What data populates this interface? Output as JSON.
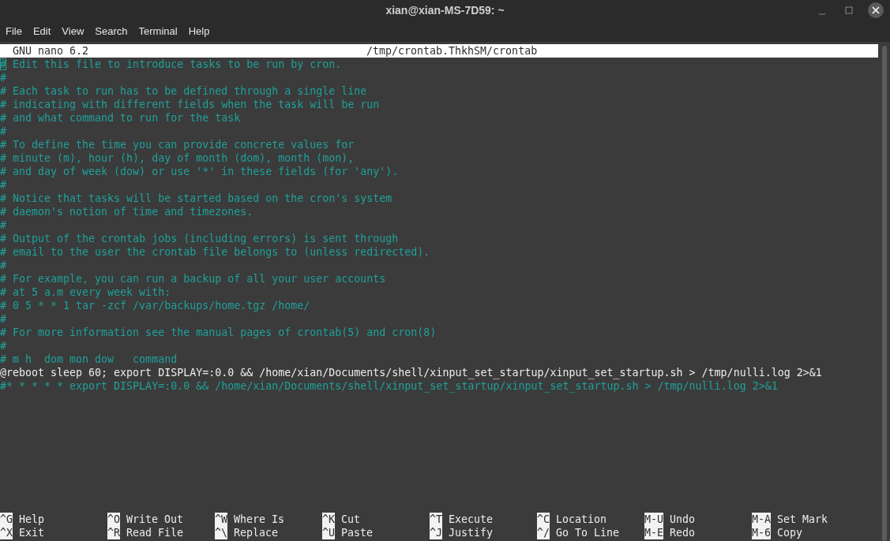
{
  "window": {
    "title": "xian@xian-MS-7D59: ~"
  },
  "menu": [
    "File",
    "Edit",
    "View",
    "Search",
    "Terminal",
    "Help"
  ],
  "header": {
    "version": "GNU nano 6.2",
    "filename": "/tmp/crontab.ThkhSM/crontab"
  },
  "lines": [
    {
      "text": "# Edit this file to introduce tasks to be run by cron.",
      "kind": "comment",
      "cursor": true
    },
    {
      "text": "#",
      "kind": "comment",
      "cursor": false
    },
    {
      "text": "# Each task to run has to be defined through a single line",
      "kind": "comment",
      "cursor": false
    },
    {
      "text": "# indicating with different fields when the task will be run",
      "kind": "comment",
      "cursor": false
    },
    {
      "text": "# and what command to run for the task",
      "kind": "comment",
      "cursor": false
    },
    {
      "text": "#",
      "kind": "comment",
      "cursor": false
    },
    {
      "text": "# To define the time you can provide concrete values for",
      "kind": "comment",
      "cursor": false
    },
    {
      "text": "# minute (m), hour (h), day of month (dom), month (mon),",
      "kind": "comment",
      "cursor": false
    },
    {
      "text": "# and day of week (dow) or use '*' in these fields (for 'any').",
      "kind": "comment",
      "cursor": false
    },
    {
      "text": "#",
      "kind": "comment",
      "cursor": false
    },
    {
      "text": "# Notice that tasks will be started based on the cron's system",
      "kind": "comment",
      "cursor": false
    },
    {
      "text": "# daemon's notion of time and timezones.",
      "kind": "comment",
      "cursor": false
    },
    {
      "text": "#",
      "kind": "comment",
      "cursor": false
    },
    {
      "text": "# Output of the crontab jobs (including errors) is sent through",
      "kind": "comment",
      "cursor": false
    },
    {
      "text": "# email to the user the crontab file belongs to (unless redirected).",
      "kind": "comment",
      "cursor": false
    },
    {
      "text": "#",
      "kind": "comment",
      "cursor": false
    },
    {
      "text": "# For example, you can run a backup of all your user accounts",
      "kind": "comment",
      "cursor": false
    },
    {
      "text": "# at 5 a.m every week with:",
      "kind": "comment",
      "cursor": false
    },
    {
      "text": "# 0 5 * * 1 tar -zcf /var/backups/home.tgz /home/",
      "kind": "comment",
      "cursor": false
    },
    {
      "text": "#",
      "kind": "comment",
      "cursor": false
    },
    {
      "text": "# For more information see the manual pages of crontab(5) and cron(8)",
      "kind": "comment",
      "cursor": false
    },
    {
      "text": "#",
      "kind": "comment",
      "cursor": false
    },
    {
      "text": "# m h  dom mon dow   command",
      "kind": "comment",
      "cursor": false
    },
    {
      "text": "@reboot sleep 60; export DISPLAY=:0.0 && /home/xian/Documents/shell/xinput_set_startup/xinput_set_startup.sh > /tmp/nulli.log 2>&1",
      "kind": "command",
      "cursor": false
    },
    {
      "text": "#* * * * * export DISPLAY=:0.0 && /home/xian/Documents/shell/xinput_set_startup/xinput_set_startup.sh > /tmp/nulli.log 2>&1",
      "kind": "comment",
      "cursor": false
    }
  ],
  "shortcuts": [
    [
      {
        "key": "^G",
        "label": "Help"
      },
      {
        "key": "^X",
        "label": "Exit"
      }
    ],
    [
      {
        "key": "^O",
        "label": "Write Out"
      },
      {
        "key": "^R",
        "label": "Read File"
      }
    ],
    [
      {
        "key": "^W",
        "label": "Where Is"
      },
      {
        "key": "^\\",
        "label": "Replace"
      }
    ],
    [
      {
        "key": "^K",
        "label": "Cut"
      },
      {
        "key": "^U",
        "label": "Paste"
      }
    ],
    [
      {
        "key": "^T",
        "label": "Execute"
      },
      {
        "key": "^J",
        "label": "Justify"
      }
    ],
    [
      {
        "key": "^C",
        "label": "Location"
      },
      {
        "key": "^/",
        "label": "Go To Line"
      }
    ],
    [
      {
        "key": "M-U",
        "label": "Undo"
      },
      {
        "key": "M-E",
        "label": "Redo"
      }
    ],
    [
      {
        "key": "M-A",
        "label": "Set Mark"
      },
      {
        "key": "M-6",
        "label": "Copy"
      }
    ]
  ]
}
